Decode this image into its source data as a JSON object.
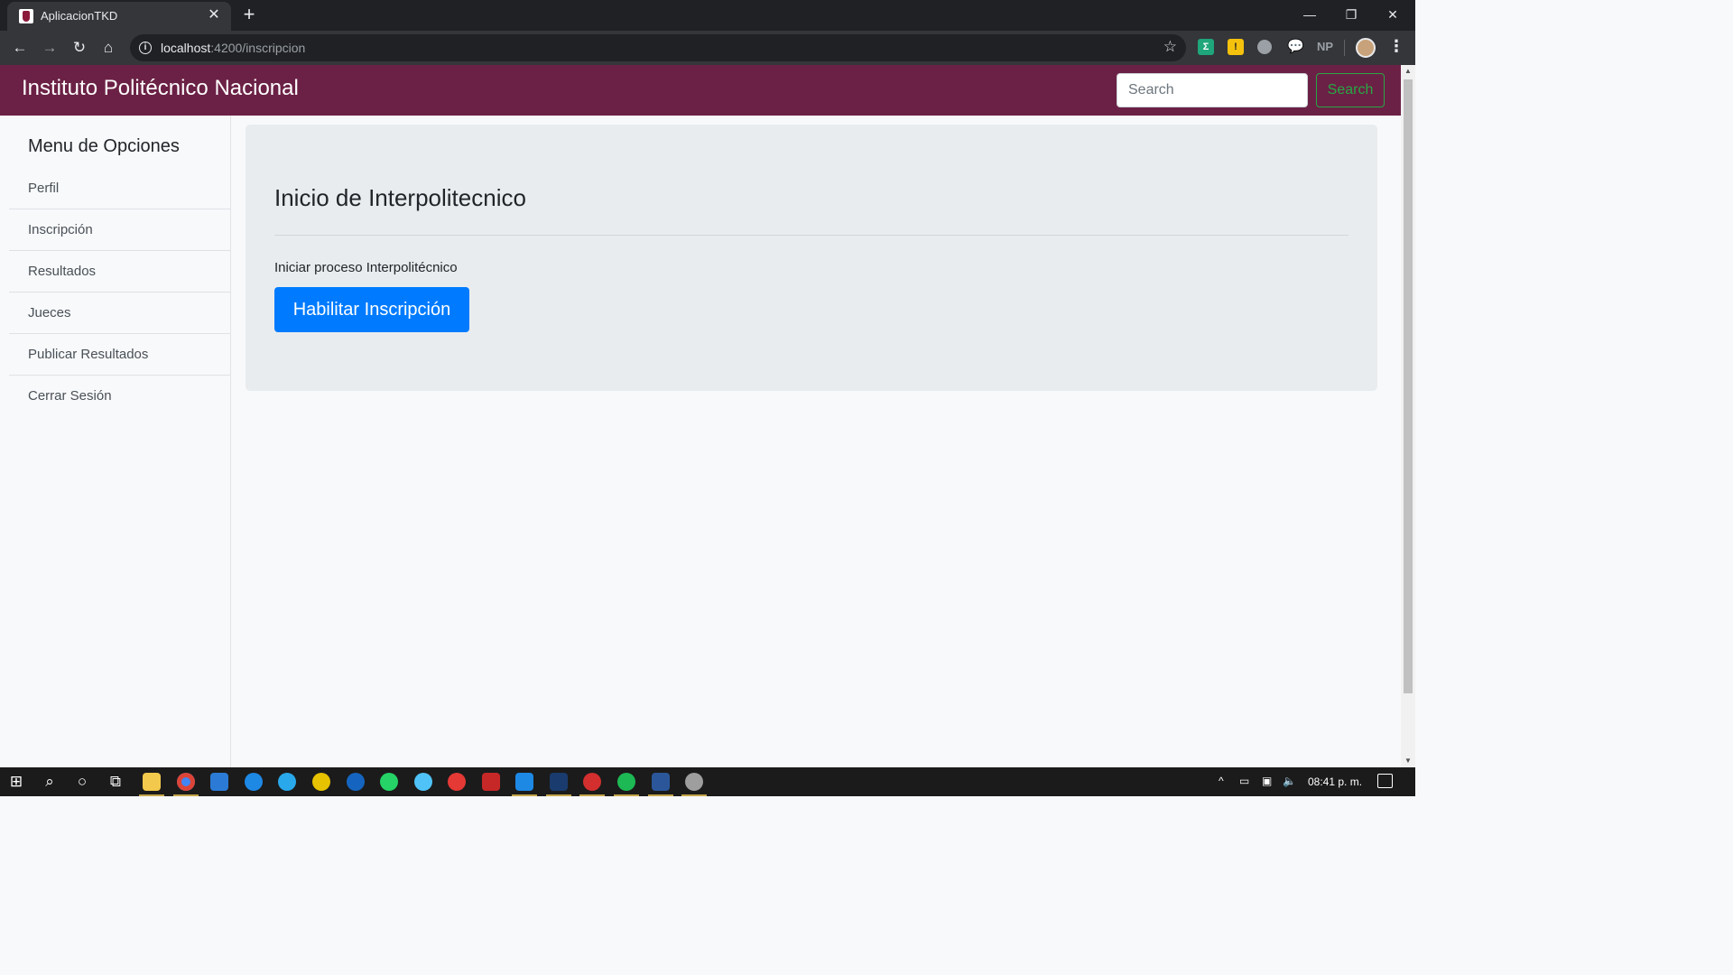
{
  "browser": {
    "tab_title": "AplicacionTKD",
    "url_host": "localhost",
    "url_rest": ":4200/inscripcion",
    "extension_np": "NP"
  },
  "navbar": {
    "brand": "Instituto Politécnico Nacional",
    "search_placeholder": "Search",
    "search_button": "Search"
  },
  "sidebar": {
    "title": "Menu de Opciones",
    "items": [
      {
        "label": "Perfil"
      },
      {
        "label": "Inscripción"
      },
      {
        "label": "Resultados"
      },
      {
        "label": "Jueces"
      },
      {
        "label": "Publicar Resultados"
      },
      {
        "label": "Cerrar Sesión"
      }
    ]
  },
  "main": {
    "title": "Inicio de Interpolitecnico",
    "lead": "Iniciar proceso Interpolitécnico",
    "button_label": "Habilitar Inscripción"
  },
  "taskbar": {
    "clock": "08:41 p. m."
  },
  "colors": {
    "navbar": "#6b2145",
    "primary": "#007bff",
    "success": "#28a745"
  }
}
